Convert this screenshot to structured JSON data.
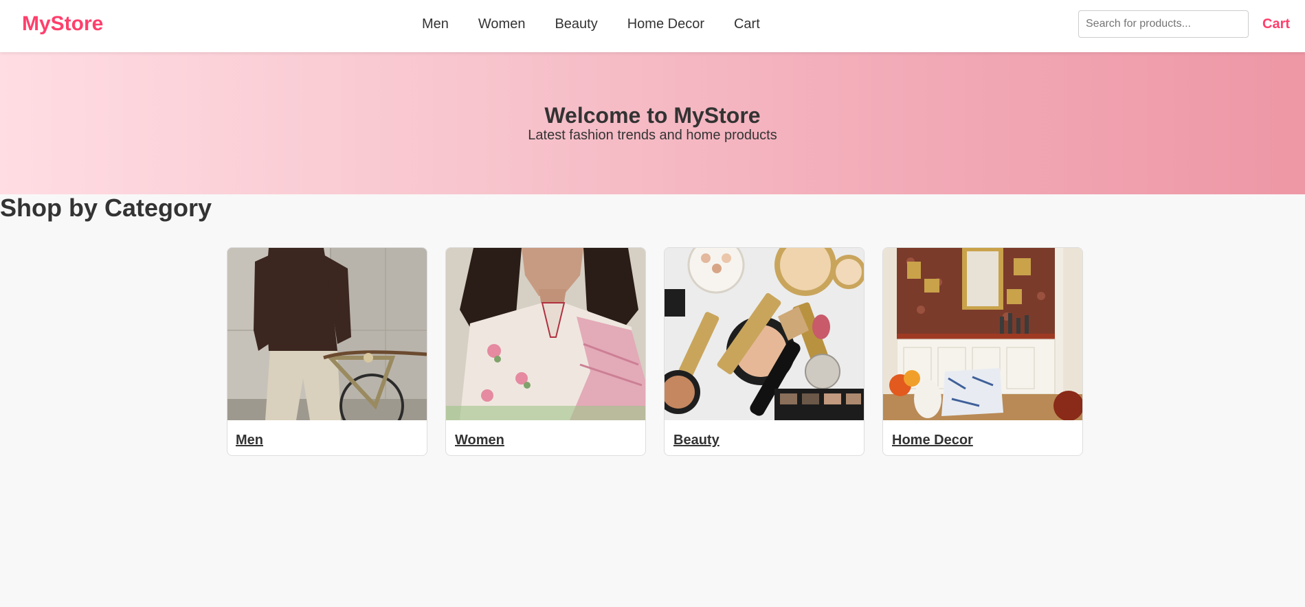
{
  "header": {
    "logo": "MyStore",
    "nav": [
      {
        "label": "Men"
      },
      {
        "label": "Women"
      },
      {
        "label": "Beauty"
      },
      {
        "label": "Home Decor"
      },
      {
        "label": "Cart"
      }
    ],
    "search": {
      "placeholder": "Search for products...",
      "value": ""
    },
    "cart_label": "Cart"
  },
  "hero": {
    "title": "Welcome to MyStore",
    "subtitle": "Latest fashion trends and home products"
  },
  "categories": {
    "title": "Shop by Category",
    "items": [
      {
        "label": "Men"
      },
      {
        "label": "Women"
      },
      {
        "label": "Beauty"
      },
      {
        "label": "Home Decor"
      }
    ]
  },
  "colors": {
    "brand": "#ff3f6c",
    "text": "#333333",
    "hero_start": "#ffdde3",
    "hero_end": "#ee97a5",
    "page_bg": "#f8f8f8"
  }
}
